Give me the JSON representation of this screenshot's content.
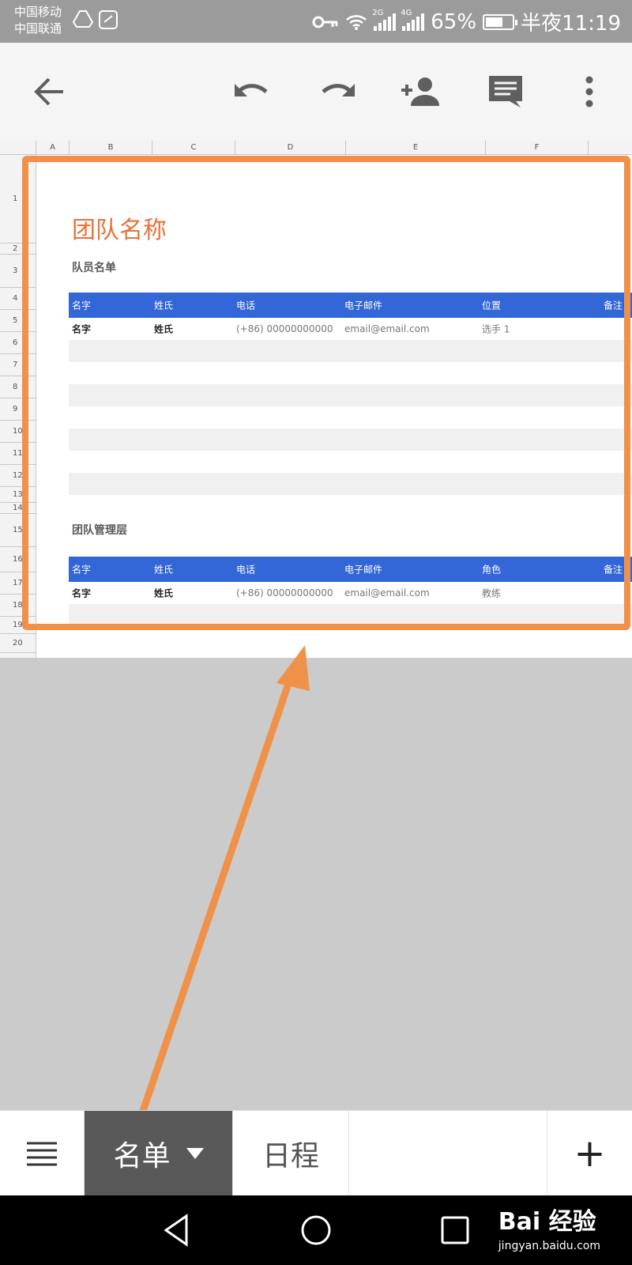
{
  "status_bar": {
    "carrier_1": "中国移动",
    "carrier_2": "中国联通",
    "net_1": "2G",
    "net_2": "4G",
    "battery_text": "65%",
    "battery_level": 0.65,
    "time": "半夜11:19"
  },
  "toolbar": {
    "icons": [
      "arrow-back-icon",
      "undo-icon",
      "redo-icon",
      "add-person-icon",
      "comment-icon",
      "more-vert-icon"
    ]
  },
  "sheet": {
    "columns": [
      "A",
      "B",
      "C",
      "D",
      "E",
      "F"
    ],
    "rows": [
      "1",
      "2",
      "3",
      "4",
      "5",
      "6",
      "7",
      "8",
      "9",
      "10",
      "11",
      "12",
      "13",
      "14",
      "15",
      "16",
      "17",
      "18",
      "19",
      "20"
    ],
    "title": "团队名称",
    "roster": {
      "label": "队员名单",
      "headers": [
        "名字",
        "姓氏",
        "电话",
        "电子邮件",
        "位置",
        "备注"
      ],
      "first_row": [
        "名字",
        "姓氏",
        "(+86) 00000000000",
        "email@email.com",
        "选手 1",
        ""
      ]
    },
    "management": {
      "label": "团队管理层",
      "headers": [
        "名字",
        "姓氏",
        "电话",
        "电子邮件",
        "角色",
        "备注"
      ],
      "first_row": [
        "名字",
        "姓氏",
        "(+86) 00000000000",
        "email@email.com",
        "教练",
        ""
      ]
    }
  },
  "tabs": {
    "menu_icon": "menu-icon",
    "items": [
      {
        "label": "名单",
        "active": true
      },
      {
        "label": "日程",
        "active": false
      }
    ],
    "add_label": "+"
  },
  "watermark": {
    "logo": "Bai 经验",
    "url": "jingyan.baidu.com"
  },
  "colors": {
    "accent": "#e8733a",
    "header_blue": "#3366d6",
    "highlight": "#f0914a"
  }
}
